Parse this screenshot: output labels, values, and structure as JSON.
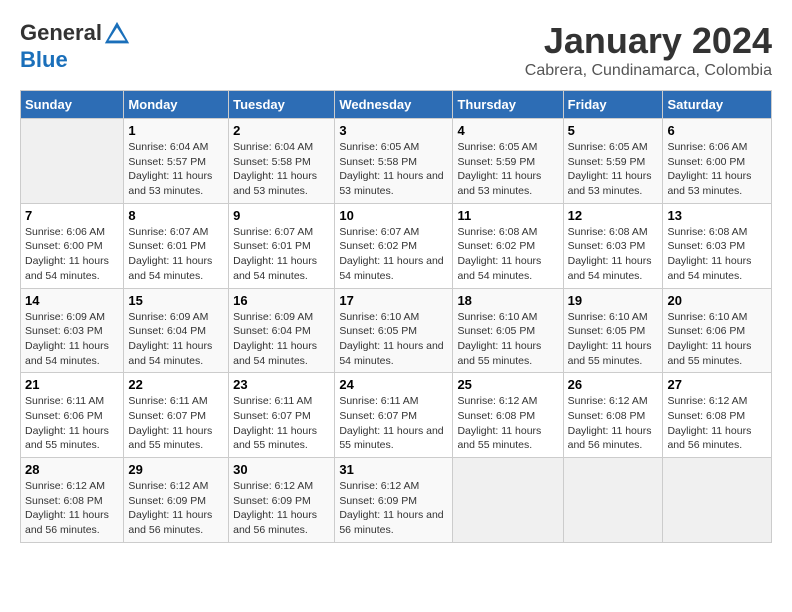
{
  "header": {
    "logo_general": "General",
    "logo_blue": "Blue",
    "title": "January 2024",
    "location": "Cabrera, Cundinamarca, Colombia"
  },
  "weekdays": [
    "Sunday",
    "Monday",
    "Tuesday",
    "Wednesday",
    "Thursday",
    "Friday",
    "Saturday"
  ],
  "weeks": [
    [
      {
        "day": "",
        "sunrise": "",
        "sunset": "",
        "daylight": ""
      },
      {
        "day": "1",
        "sunrise": "Sunrise: 6:04 AM",
        "sunset": "Sunset: 5:57 PM",
        "daylight": "Daylight: 11 hours and 53 minutes."
      },
      {
        "day": "2",
        "sunrise": "Sunrise: 6:04 AM",
        "sunset": "Sunset: 5:58 PM",
        "daylight": "Daylight: 11 hours and 53 minutes."
      },
      {
        "day": "3",
        "sunrise": "Sunrise: 6:05 AM",
        "sunset": "Sunset: 5:58 PM",
        "daylight": "Daylight: 11 hours and 53 minutes."
      },
      {
        "day": "4",
        "sunrise": "Sunrise: 6:05 AM",
        "sunset": "Sunset: 5:59 PM",
        "daylight": "Daylight: 11 hours and 53 minutes."
      },
      {
        "day": "5",
        "sunrise": "Sunrise: 6:05 AM",
        "sunset": "Sunset: 5:59 PM",
        "daylight": "Daylight: 11 hours and 53 minutes."
      },
      {
        "day": "6",
        "sunrise": "Sunrise: 6:06 AM",
        "sunset": "Sunset: 6:00 PM",
        "daylight": "Daylight: 11 hours and 53 minutes."
      }
    ],
    [
      {
        "day": "7",
        "sunrise": "Sunrise: 6:06 AM",
        "sunset": "Sunset: 6:00 PM",
        "daylight": "Daylight: 11 hours and 54 minutes."
      },
      {
        "day": "8",
        "sunrise": "Sunrise: 6:07 AM",
        "sunset": "Sunset: 6:01 PM",
        "daylight": "Daylight: 11 hours and 54 minutes."
      },
      {
        "day": "9",
        "sunrise": "Sunrise: 6:07 AM",
        "sunset": "Sunset: 6:01 PM",
        "daylight": "Daylight: 11 hours and 54 minutes."
      },
      {
        "day": "10",
        "sunrise": "Sunrise: 6:07 AM",
        "sunset": "Sunset: 6:02 PM",
        "daylight": "Daylight: 11 hours and 54 minutes."
      },
      {
        "day": "11",
        "sunrise": "Sunrise: 6:08 AM",
        "sunset": "Sunset: 6:02 PM",
        "daylight": "Daylight: 11 hours and 54 minutes."
      },
      {
        "day": "12",
        "sunrise": "Sunrise: 6:08 AM",
        "sunset": "Sunset: 6:03 PM",
        "daylight": "Daylight: 11 hours and 54 minutes."
      },
      {
        "day": "13",
        "sunrise": "Sunrise: 6:08 AM",
        "sunset": "Sunset: 6:03 PM",
        "daylight": "Daylight: 11 hours and 54 minutes."
      }
    ],
    [
      {
        "day": "14",
        "sunrise": "Sunrise: 6:09 AM",
        "sunset": "Sunset: 6:03 PM",
        "daylight": "Daylight: 11 hours and 54 minutes."
      },
      {
        "day": "15",
        "sunrise": "Sunrise: 6:09 AM",
        "sunset": "Sunset: 6:04 PM",
        "daylight": "Daylight: 11 hours and 54 minutes."
      },
      {
        "day": "16",
        "sunrise": "Sunrise: 6:09 AM",
        "sunset": "Sunset: 6:04 PM",
        "daylight": "Daylight: 11 hours and 54 minutes."
      },
      {
        "day": "17",
        "sunrise": "Sunrise: 6:10 AM",
        "sunset": "Sunset: 6:05 PM",
        "daylight": "Daylight: 11 hours and 54 minutes."
      },
      {
        "day": "18",
        "sunrise": "Sunrise: 6:10 AM",
        "sunset": "Sunset: 6:05 PM",
        "daylight": "Daylight: 11 hours and 55 minutes."
      },
      {
        "day": "19",
        "sunrise": "Sunrise: 6:10 AM",
        "sunset": "Sunset: 6:05 PM",
        "daylight": "Daylight: 11 hours and 55 minutes."
      },
      {
        "day": "20",
        "sunrise": "Sunrise: 6:10 AM",
        "sunset": "Sunset: 6:06 PM",
        "daylight": "Daylight: 11 hours and 55 minutes."
      }
    ],
    [
      {
        "day": "21",
        "sunrise": "Sunrise: 6:11 AM",
        "sunset": "Sunset: 6:06 PM",
        "daylight": "Daylight: 11 hours and 55 minutes."
      },
      {
        "day": "22",
        "sunrise": "Sunrise: 6:11 AM",
        "sunset": "Sunset: 6:07 PM",
        "daylight": "Daylight: 11 hours and 55 minutes."
      },
      {
        "day": "23",
        "sunrise": "Sunrise: 6:11 AM",
        "sunset": "Sunset: 6:07 PM",
        "daylight": "Daylight: 11 hours and 55 minutes."
      },
      {
        "day": "24",
        "sunrise": "Sunrise: 6:11 AM",
        "sunset": "Sunset: 6:07 PM",
        "daylight": "Daylight: 11 hours and 55 minutes."
      },
      {
        "day": "25",
        "sunrise": "Sunrise: 6:12 AM",
        "sunset": "Sunset: 6:08 PM",
        "daylight": "Daylight: 11 hours and 55 minutes."
      },
      {
        "day": "26",
        "sunrise": "Sunrise: 6:12 AM",
        "sunset": "Sunset: 6:08 PM",
        "daylight": "Daylight: 11 hours and 56 minutes."
      },
      {
        "day": "27",
        "sunrise": "Sunrise: 6:12 AM",
        "sunset": "Sunset: 6:08 PM",
        "daylight": "Daylight: 11 hours and 56 minutes."
      }
    ],
    [
      {
        "day": "28",
        "sunrise": "Sunrise: 6:12 AM",
        "sunset": "Sunset: 6:08 PM",
        "daylight": "Daylight: 11 hours and 56 minutes."
      },
      {
        "day": "29",
        "sunrise": "Sunrise: 6:12 AM",
        "sunset": "Sunset: 6:09 PM",
        "daylight": "Daylight: 11 hours and 56 minutes."
      },
      {
        "day": "30",
        "sunrise": "Sunrise: 6:12 AM",
        "sunset": "Sunset: 6:09 PM",
        "daylight": "Daylight: 11 hours and 56 minutes."
      },
      {
        "day": "31",
        "sunrise": "Sunrise: 6:12 AM",
        "sunset": "Sunset: 6:09 PM",
        "daylight": "Daylight: 11 hours and 56 minutes."
      },
      {
        "day": "",
        "sunrise": "",
        "sunset": "",
        "daylight": ""
      },
      {
        "day": "",
        "sunrise": "",
        "sunset": "",
        "daylight": ""
      },
      {
        "day": "",
        "sunrise": "",
        "sunset": "",
        "daylight": ""
      }
    ]
  ]
}
